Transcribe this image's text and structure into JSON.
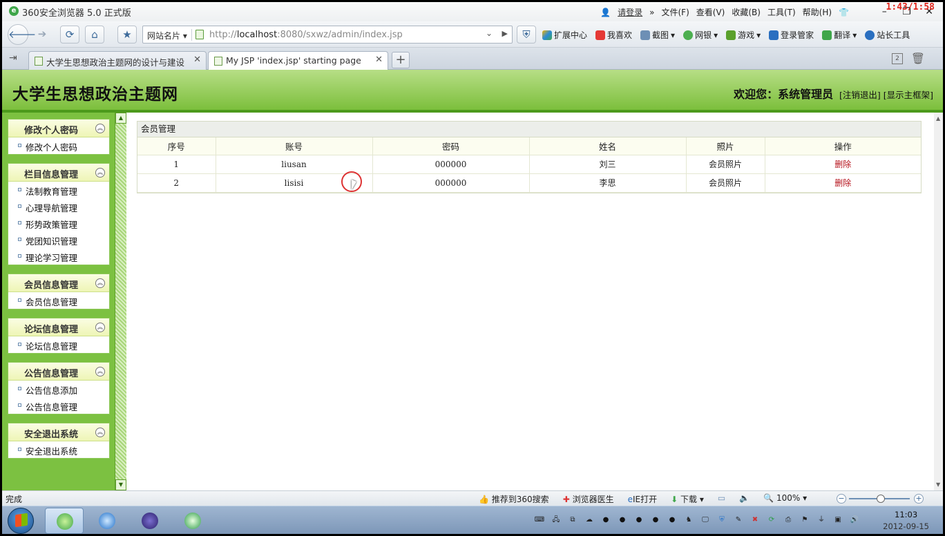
{
  "window": {
    "title": "360安全浏览器 5.0 正式版",
    "login_label": "请登录",
    "menu": [
      "文件(F)",
      "查看(V)",
      "收藏(B)",
      "工具(T)",
      "帮助(H)"
    ],
    "clock_overlay": "1:43/1:58"
  },
  "toolbar": {
    "site_name": "网站名片",
    "url_host": "localhost",
    "url_prefix": "http://",
    "url_suffix": ":8080/sxwz/admin/index.jsp",
    "tools": [
      "扩展中心",
      "我喜欢",
      "截图",
      "网银",
      "游戏",
      "登录管家",
      "翻译",
      "站长工具"
    ]
  },
  "tabs": [
    {
      "label": "大学生思想政治主题网的设计与建设",
      "active": false
    },
    {
      "label": "My JSP 'index.jsp' starting page",
      "active": true
    }
  ],
  "header": {
    "site_title": "大学生思想政治主题网",
    "welcome": "欢迎您：系统管理员",
    "logout": "[注销退出]",
    "show_frame": "[显示主框架]"
  },
  "sidebar": [
    {
      "title": "修改个人密码",
      "items": [
        "修改个人密码"
      ]
    },
    {
      "title": "栏目信息管理",
      "items": [
        "法制教育管理",
        "心理导航管理",
        "形势政策管理",
        "党团知识管理",
        "理论学习管理"
      ]
    },
    {
      "title": "会员信息管理",
      "items": [
        "会员信息管理"
      ]
    },
    {
      "title": "论坛信息管理",
      "items": [
        "论坛信息管理"
      ]
    },
    {
      "title": "公告信息管理",
      "items": [
        "公告信息添加",
        "公告信息管理"
      ]
    },
    {
      "title": "安全退出系统",
      "items": [
        "安全退出系统"
      ]
    }
  ],
  "panel": {
    "title": "会员管理",
    "columns": [
      "序号",
      "账号",
      "密码",
      "姓名",
      "照片",
      "操作"
    ],
    "rows": [
      [
        "1",
        "liusan",
        "000000",
        "刘三",
        "会员照片",
        "删除"
      ],
      [
        "2",
        "lisisi",
        "000000",
        "李思",
        "会员照片",
        "删除"
      ]
    ]
  },
  "statusbar": {
    "status": "完成",
    "items": [
      "推荐到360搜索",
      "浏览器医生",
      "IE打开",
      "下载"
    ],
    "zoom": "100%"
  },
  "taskbar": {
    "time": "11:03",
    "date": "2012-09-15"
  },
  "colors": {
    "header_green": "#7cbf3c",
    "sidebar_green": "#7cc141",
    "delete_red": "#b5121b"
  }
}
